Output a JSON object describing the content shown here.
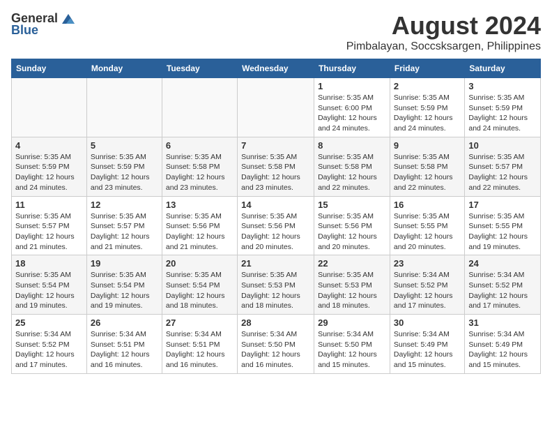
{
  "logo": {
    "general": "General",
    "blue": "Blue"
  },
  "title": "August 2024",
  "subtitle": "Pimbalayan, Soccsksargen, Philippines",
  "days_of_week": [
    "Sunday",
    "Monday",
    "Tuesday",
    "Wednesday",
    "Thursday",
    "Friday",
    "Saturday"
  ],
  "weeks": [
    [
      {
        "day": "",
        "info": ""
      },
      {
        "day": "",
        "info": ""
      },
      {
        "day": "",
        "info": ""
      },
      {
        "day": "",
        "info": ""
      },
      {
        "day": "1",
        "info": "Sunrise: 5:35 AM\nSunset: 6:00 PM\nDaylight: 12 hours\nand 24 minutes."
      },
      {
        "day": "2",
        "info": "Sunrise: 5:35 AM\nSunset: 5:59 PM\nDaylight: 12 hours\nand 24 minutes."
      },
      {
        "day": "3",
        "info": "Sunrise: 5:35 AM\nSunset: 5:59 PM\nDaylight: 12 hours\nand 24 minutes."
      }
    ],
    [
      {
        "day": "4",
        "info": "Sunrise: 5:35 AM\nSunset: 5:59 PM\nDaylight: 12 hours\nand 24 minutes."
      },
      {
        "day": "5",
        "info": "Sunrise: 5:35 AM\nSunset: 5:59 PM\nDaylight: 12 hours\nand 23 minutes."
      },
      {
        "day": "6",
        "info": "Sunrise: 5:35 AM\nSunset: 5:58 PM\nDaylight: 12 hours\nand 23 minutes."
      },
      {
        "day": "7",
        "info": "Sunrise: 5:35 AM\nSunset: 5:58 PM\nDaylight: 12 hours\nand 23 minutes."
      },
      {
        "day": "8",
        "info": "Sunrise: 5:35 AM\nSunset: 5:58 PM\nDaylight: 12 hours\nand 22 minutes."
      },
      {
        "day": "9",
        "info": "Sunrise: 5:35 AM\nSunset: 5:58 PM\nDaylight: 12 hours\nand 22 minutes."
      },
      {
        "day": "10",
        "info": "Sunrise: 5:35 AM\nSunset: 5:57 PM\nDaylight: 12 hours\nand 22 minutes."
      }
    ],
    [
      {
        "day": "11",
        "info": "Sunrise: 5:35 AM\nSunset: 5:57 PM\nDaylight: 12 hours\nand 21 minutes."
      },
      {
        "day": "12",
        "info": "Sunrise: 5:35 AM\nSunset: 5:57 PM\nDaylight: 12 hours\nand 21 minutes."
      },
      {
        "day": "13",
        "info": "Sunrise: 5:35 AM\nSunset: 5:56 PM\nDaylight: 12 hours\nand 21 minutes."
      },
      {
        "day": "14",
        "info": "Sunrise: 5:35 AM\nSunset: 5:56 PM\nDaylight: 12 hours\nand 20 minutes."
      },
      {
        "day": "15",
        "info": "Sunrise: 5:35 AM\nSunset: 5:56 PM\nDaylight: 12 hours\nand 20 minutes."
      },
      {
        "day": "16",
        "info": "Sunrise: 5:35 AM\nSunset: 5:55 PM\nDaylight: 12 hours\nand 20 minutes."
      },
      {
        "day": "17",
        "info": "Sunrise: 5:35 AM\nSunset: 5:55 PM\nDaylight: 12 hours\nand 19 minutes."
      }
    ],
    [
      {
        "day": "18",
        "info": "Sunrise: 5:35 AM\nSunset: 5:54 PM\nDaylight: 12 hours\nand 19 minutes."
      },
      {
        "day": "19",
        "info": "Sunrise: 5:35 AM\nSunset: 5:54 PM\nDaylight: 12 hours\nand 19 minutes."
      },
      {
        "day": "20",
        "info": "Sunrise: 5:35 AM\nSunset: 5:54 PM\nDaylight: 12 hours\nand 18 minutes."
      },
      {
        "day": "21",
        "info": "Sunrise: 5:35 AM\nSunset: 5:53 PM\nDaylight: 12 hours\nand 18 minutes."
      },
      {
        "day": "22",
        "info": "Sunrise: 5:35 AM\nSunset: 5:53 PM\nDaylight: 12 hours\nand 18 minutes."
      },
      {
        "day": "23",
        "info": "Sunrise: 5:34 AM\nSunset: 5:52 PM\nDaylight: 12 hours\nand 17 minutes."
      },
      {
        "day": "24",
        "info": "Sunrise: 5:34 AM\nSunset: 5:52 PM\nDaylight: 12 hours\nand 17 minutes."
      }
    ],
    [
      {
        "day": "25",
        "info": "Sunrise: 5:34 AM\nSunset: 5:52 PM\nDaylight: 12 hours\nand 17 minutes."
      },
      {
        "day": "26",
        "info": "Sunrise: 5:34 AM\nSunset: 5:51 PM\nDaylight: 12 hours\nand 16 minutes."
      },
      {
        "day": "27",
        "info": "Sunrise: 5:34 AM\nSunset: 5:51 PM\nDaylight: 12 hours\nand 16 minutes."
      },
      {
        "day": "28",
        "info": "Sunrise: 5:34 AM\nSunset: 5:50 PM\nDaylight: 12 hours\nand 16 minutes."
      },
      {
        "day": "29",
        "info": "Sunrise: 5:34 AM\nSunset: 5:50 PM\nDaylight: 12 hours\nand 15 minutes."
      },
      {
        "day": "30",
        "info": "Sunrise: 5:34 AM\nSunset: 5:49 PM\nDaylight: 12 hours\nand 15 minutes."
      },
      {
        "day": "31",
        "info": "Sunrise: 5:34 AM\nSunset: 5:49 PM\nDaylight: 12 hours\nand 15 minutes."
      }
    ]
  ]
}
